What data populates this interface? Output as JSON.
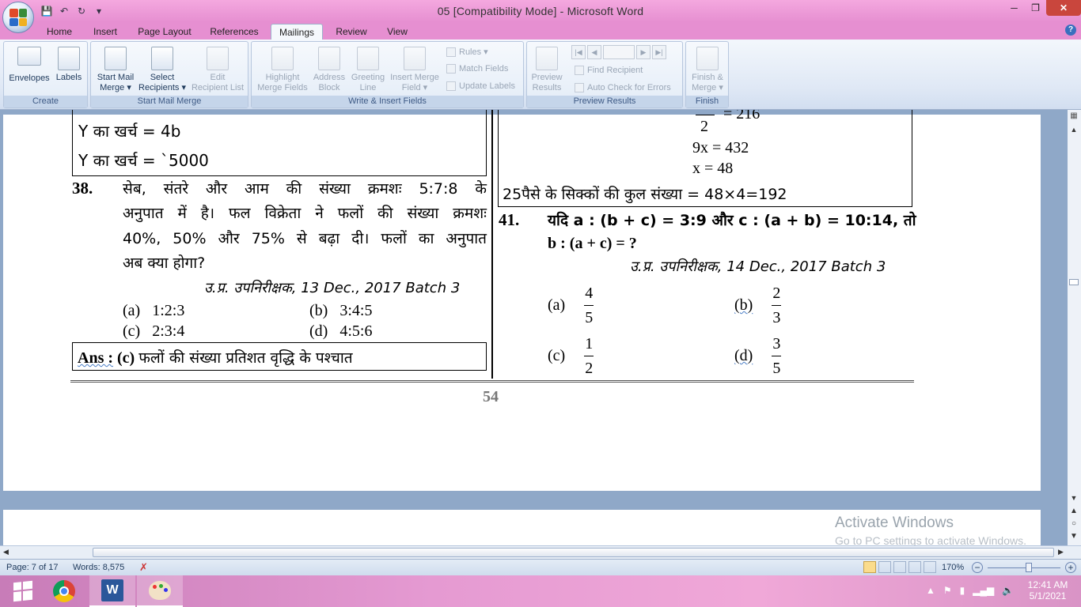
{
  "window": {
    "title": "05 [Compatibility Mode] - Microsoft Word"
  },
  "tabs": [
    "Home",
    "Insert",
    "Page Layout",
    "References",
    "Mailings",
    "Review",
    "View"
  ],
  "active_tab": "Mailings",
  "ribbon": {
    "create": {
      "label": "Create",
      "envelopes": "Envelopes",
      "labels": "Labels"
    },
    "start": {
      "label": "Start Mail Merge",
      "start_mail_merge": "Start Mail",
      "start_mail_merge2": "Merge ▾",
      "select_recipients": "Select",
      "select_recipients2": "Recipients ▾",
      "edit_list": "Edit",
      "edit_list2": "Recipient List"
    },
    "write": {
      "label": "Write & Insert Fields",
      "highlight": "Highlight",
      "highlight2": "Merge Fields",
      "address": "Address",
      "address2": "Block",
      "greeting": "Greeting",
      "greeting2": "Line",
      "insert_merge": "Insert Merge",
      "insert_merge2": "Field ▾",
      "rules": "Rules ▾",
      "match": "Match Fields",
      "update": "Update Labels"
    },
    "preview": {
      "label": "Preview Results",
      "preview": "Preview",
      "preview2": "Results",
      "find": "Find Recipient",
      "auto_check": "Auto Check for Errors"
    },
    "finish": {
      "label": "Finish",
      "finish": "Finish &",
      "finish2": "Merge ▾"
    }
  },
  "document": {
    "left_box_line1": "Y का खर्च = 4b",
    "left_box_line2": "Y का खर्च = `5000",
    "q38_num": "38.",
    "q38_line1": "सेब, संतरे और आम की संख्या क्रमशः 5:7:8 के",
    "q38_line2": "अनुपात में है। फल विक्रेता ने फलों की संख्या क्रमशः",
    "q38_line3": "40%, 50% और 75% से बढ़ा दी। फलों का अनुपात",
    "q38_line4": "अब क्या होगा?",
    "q38_source": "उ.प्र. उपनिरीक्षक, 13 Dec., 2017 Batch 3",
    "q38_opts": [
      {
        "k": "(a)",
        "v": "1:2:3"
      },
      {
        "k": "(b)",
        "v": "3:4:5"
      },
      {
        "k": "(c)",
        "v": "2:3:4"
      },
      {
        "k": "(d)",
        "v": "4:5:6"
      }
    ],
    "ans_label": "Ans :",
    "ans_key": "(c)",
    "ans_text": "फलों की संख्या प्रतिशत वृद्धि के पश्चात",
    "right_top_frag": "2",
    "right_top_eq": "= 216",
    "right_eq1": "9x = 432",
    "right_eq2": "x = 48",
    "right_total": "25पैसे के सिक्कों की कुल संख्या = 48×4=192",
    "q41_num": "41.",
    "q41_line1": "यदि a : (b + c) = 3:9 और c : (a + b) = 10:14, तो",
    "q41_line2": "b : (a + c) = ?",
    "q41_source": "उ.प्र. उपनिरीक्षक, 14 Dec., 2017 Batch 3",
    "q41_opts": [
      {
        "k": "(a)",
        "n": "4",
        "d": "5"
      },
      {
        "k": "(b)",
        "n": "2",
        "d": "3"
      },
      {
        "k": "(c)",
        "n": "1",
        "d": "2"
      },
      {
        "k": "(d)",
        "n": "3",
        "d": "5"
      }
    ],
    "page_number": "54"
  },
  "watermark": {
    "line1": "Activate Windows",
    "line2": "Go to PC settings to activate Windows."
  },
  "status": {
    "page": "Page: 7 of 17",
    "words": "Words: 8,575",
    "zoom": "170%"
  },
  "taskbar": {
    "time": "12:41 AM",
    "date": "5/1/2021"
  }
}
